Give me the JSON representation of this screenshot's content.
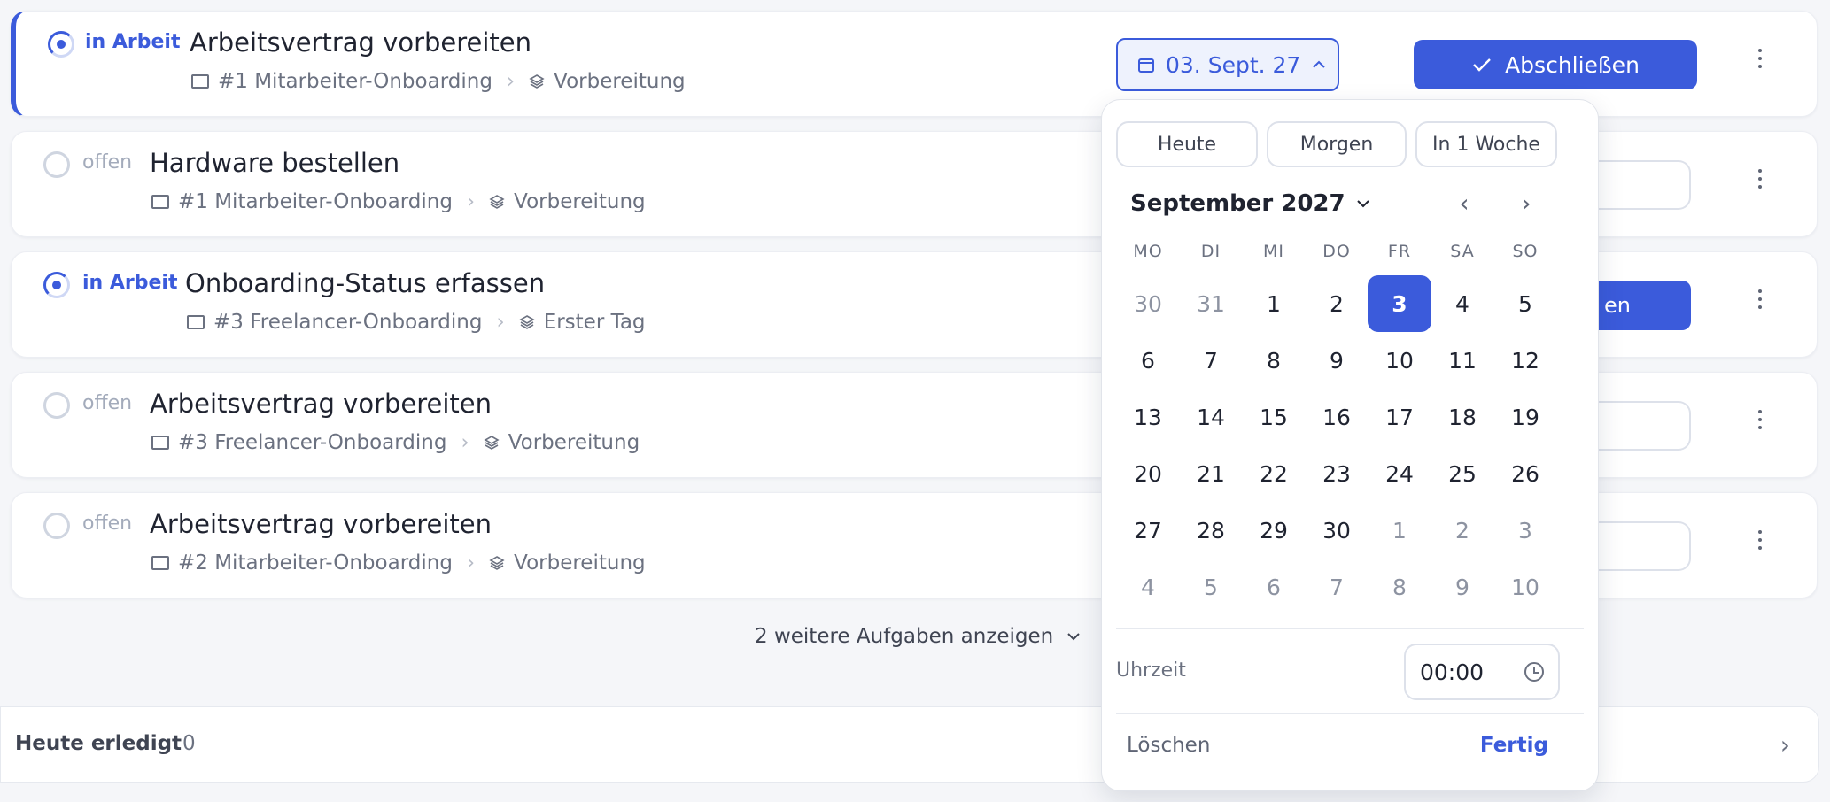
{
  "colors": {
    "accent": "#3b5bdb",
    "muted": "#a3abbb"
  },
  "tasks": [
    {
      "status": "in Arbeit",
      "title": "Arbeitsvertrag vorbereiten",
      "project": "#1 Mitarbeiter-Onboarding",
      "phase": "Vorbereitung"
    },
    {
      "status": "offen",
      "title": "Hardware bestellen",
      "project": "#1 Mitarbeiter-Onboarding",
      "phase": "Vorbereitung"
    },
    {
      "status": "in Arbeit",
      "title": "Onboarding-Status erfassen",
      "project": "#3 Freelancer-Onboarding",
      "phase": "Erster Tag"
    },
    {
      "status": "offen",
      "title": "Arbeitsvertrag vorbereiten",
      "project": "#3 Freelancer-Onboarding",
      "phase": "Vorbereitung"
    },
    {
      "status": "offen",
      "title": "Arbeitsvertrag vorbereiten",
      "project": "#2 Mitarbeiter-Onboarding",
      "phase": "Vorbereitung"
    }
  ],
  "task1": {
    "date": "03. Sept. 27",
    "complete_label": "Abschließen"
  },
  "task3": {
    "complete_fragment": "en"
  },
  "more_tasks": "2 weitere Aufgaben anzeigen",
  "today_done": {
    "label": "Heute erledigt",
    "count": "0"
  },
  "datepicker": {
    "quick": [
      "Heute",
      "Morgen",
      "In 1 Woche"
    ],
    "month": "September 2027",
    "weekdays": [
      "MO",
      "DI",
      "MI",
      "DO",
      "FR",
      "SA",
      "SO"
    ],
    "weeks": [
      [
        "30",
        "31",
        "1",
        "2",
        "3",
        "4",
        "5"
      ],
      [
        "6",
        "7",
        "8",
        "9",
        "10",
        "11",
        "12"
      ],
      [
        "13",
        "14",
        "15",
        "16",
        "17",
        "18",
        "19"
      ],
      [
        "20",
        "21",
        "22",
        "23",
        "24",
        "25",
        "26"
      ],
      [
        "27",
        "28",
        "29",
        "30",
        "1",
        "2",
        "3"
      ],
      [
        "4",
        "5",
        "6",
        "7",
        "8",
        "9",
        "10"
      ]
    ],
    "selected": "3",
    "time_label": "Uhrzeit",
    "time": "00:00",
    "clear": "Löschen",
    "done": "Fertig"
  }
}
